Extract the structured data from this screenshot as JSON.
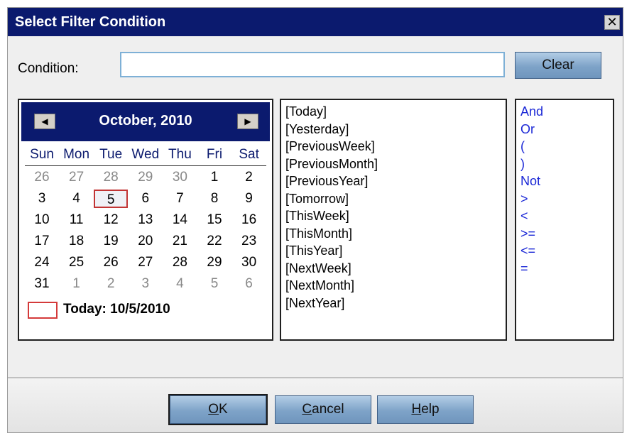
{
  "dialog": {
    "title": "Select Filter Condition",
    "close_glyph": "✕"
  },
  "condition": {
    "label": "Condition:",
    "value": "",
    "clear_label": "Clear"
  },
  "calendar": {
    "month_title": "October, 2010",
    "prev_glyph": "◀",
    "next_glyph": "▶",
    "days_of_week": [
      "Sun",
      "Mon",
      "Tue",
      "Wed",
      "Thu",
      "Fri",
      "Sat"
    ],
    "weeks": [
      [
        "26",
        "27",
        "28",
        "29",
        "30",
        "1",
        "2"
      ],
      [
        "3",
        "4",
        "5",
        "6",
        "7",
        "8",
        "9"
      ],
      [
        "10",
        "11",
        "12",
        "13",
        "14",
        "15",
        "16"
      ],
      [
        "17",
        "18",
        "19",
        "20",
        "21",
        "22",
        "23"
      ],
      [
        "24",
        "25",
        "26",
        "27",
        "28",
        "29",
        "30"
      ],
      [
        "31",
        "1",
        "2",
        "3",
        "4",
        "5",
        "6"
      ]
    ],
    "other_month_cells": [
      [
        0,
        0
      ],
      [
        0,
        1
      ],
      [
        0,
        2
      ],
      [
        0,
        3
      ],
      [
        0,
        4
      ],
      [
        5,
        1
      ],
      [
        5,
        2
      ],
      [
        5,
        3
      ],
      [
        5,
        4
      ],
      [
        5,
        5
      ],
      [
        5,
        6
      ]
    ],
    "selected_cell": [
      1,
      2
    ],
    "today_text": "Today: 10/5/2010"
  },
  "date_keywords": [
    "[Today]",
    "[Yesterday]",
    "[PreviousWeek]",
    "[PreviousMonth]",
    "[PreviousYear]",
    "[Tomorrow]",
    "[ThisWeek]",
    "[ThisMonth]",
    "[ThisYear]",
    "[NextWeek]",
    "[NextMonth]",
    "[NextYear]"
  ],
  "operators": [
    "And",
    "Or",
    "(",
    ")",
    "Not",
    ">",
    "<",
    ">=",
    "<=",
    "="
  ],
  "footer": {
    "ok_mnemonic": "O",
    "ok_rest": "K",
    "cancel_mnemonic": "C",
    "cancel_rest": "ancel",
    "help_mnemonic": "H",
    "help_rest": "elp"
  },
  "colors": {
    "titlebar": "#0b1a6e",
    "operator_text": "#1a27d6",
    "today_marker": "#d43a3a"
  }
}
